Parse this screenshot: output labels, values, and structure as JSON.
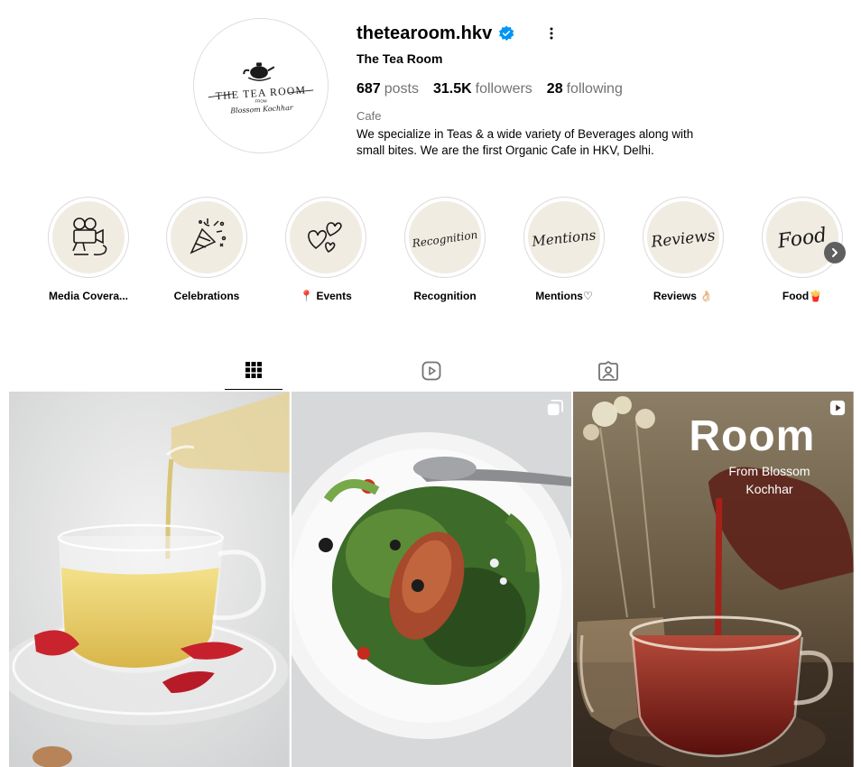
{
  "profile": {
    "username": "thetearoom.hkv",
    "display_name": "The Tea Room",
    "stats": {
      "posts_count": "687",
      "posts_label": "posts",
      "followers_count": "31.5K",
      "followers_label": "followers",
      "following_count": "28",
      "following_label": "following"
    },
    "category": "Cafe",
    "bio": "We specialize in Teas & a wide variety of Beverages along with small bites. We are the first Organic Cafe in HKV, Delhi.",
    "avatar_logo": {
      "line1": "THE TEA ROOM",
      "line2": "FROM",
      "line3": "Blossom Kochhar"
    }
  },
  "highlights": [
    {
      "label": "Media Covera...",
      "cover_icon": "video-camera-icon"
    },
    {
      "label": "Celebrations",
      "cover_icon": "party-popper-icon"
    },
    {
      "label": "📍 Events",
      "cover_icon": "hearts-icon"
    },
    {
      "label": "Recognition",
      "cover_icon": "script-text-recognition"
    },
    {
      "label": "Mentions♡",
      "cover_icon": "script-text-mentions"
    },
    {
      "label": "Reviews 👌🏻",
      "cover_icon": "script-text-reviews"
    },
    {
      "label": "Food🍟",
      "cover_icon": "script-text-food"
    }
  ],
  "highlight_covers": {
    "recognition": "Recognition",
    "mentions": "Mentions",
    "reviews": "Reviews",
    "food": "Food"
  },
  "tabs": [
    {
      "name": "posts",
      "icon": "grid-icon",
      "active": true
    },
    {
      "name": "reels",
      "icon": "reels-icon",
      "active": false
    },
    {
      "name": "tagged",
      "icon": "tagged-icon",
      "active": false
    }
  ],
  "posts": [
    {
      "type": "image",
      "subject": "tea-pour"
    },
    {
      "type": "carousel",
      "subject": "salad"
    },
    {
      "type": "reel",
      "overlay_title": "Room",
      "overlay_subtitle_1": "From Blossom",
      "overlay_subtitle_2": "Kochhar"
    }
  ],
  "colors": {
    "verified_blue": "#0095f6",
    "highlight_cover_bg": "#f1ece2",
    "text_primary": "#000000",
    "text_secondary": "#737373"
  }
}
